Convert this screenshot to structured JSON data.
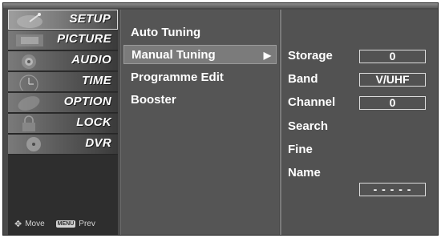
{
  "left_menu": {
    "items": [
      {
        "label": "SETUP",
        "icon": "satellite-dish-icon",
        "active": true
      },
      {
        "label": "PICTURE",
        "icon": "picture-icon"
      },
      {
        "label": "AUDIO",
        "icon": "speaker-icon"
      },
      {
        "label": "TIME",
        "icon": "clock-icon"
      },
      {
        "label": "OPTION",
        "icon": "option-icon"
      },
      {
        "label": "LOCK",
        "icon": "lock-icon"
      },
      {
        "label": "DVR",
        "icon": "disc-icon"
      }
    ],
    "help": {
      "move_label": "Move",
      "menu_badge": "MENU",
      "prev_label": "Prev"
    }
  },
  "submenu": {
    "items": [
      {
        "label": "Auto Tuning"
      },
      {
        "label": "Manual Tuning",
        "selected": true
      },
      {
        "label": "Programme Edit"
      },
      {
        "label": "Booster"
      }
    ]
  },
  "manual_tuning": {
    "storage": {
      "label": "Storage",
      "value": "0"
    },
    "band": {
      "label": "Band",
      "value": "V/UHF"
    },
    "channel": {
      "label": "Channel",
      "value": "0"
    },
    "search": {
      "label": "Search"
    },
    "fine": {
      "label": "Fine"
    },
    "name": {
      "label": "Name",
      "value": "- - - - -"
    }
  },
  "colors": {
    "panel_bg": "#4a4a4a",
    "highlight": "#7b7b7b",
    "text": "#ffffff"
  }
}
